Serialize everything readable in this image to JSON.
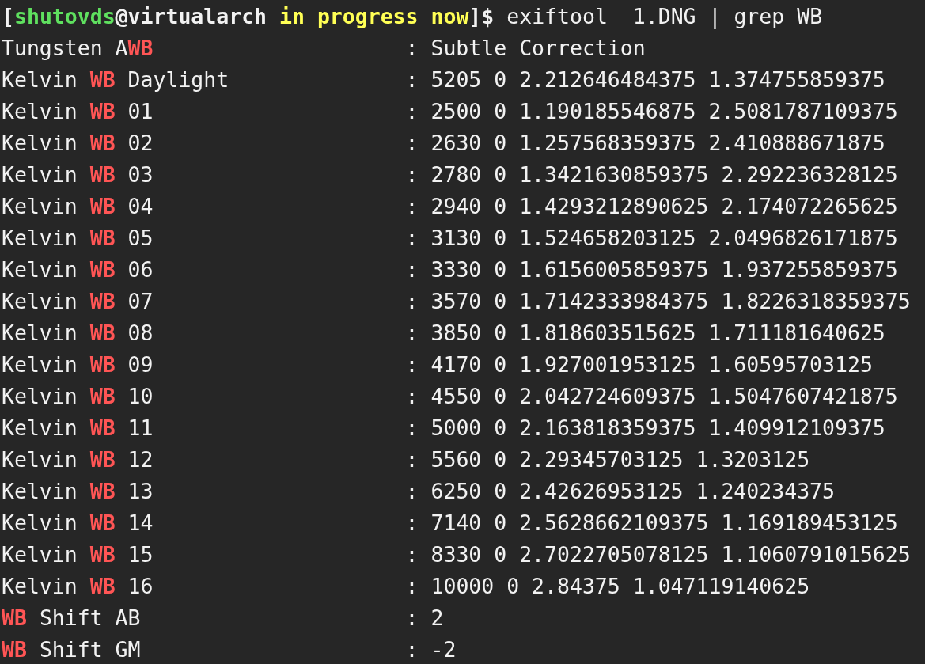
{
  "terminal": {
    "lines": [
      {
        "segments": [
          {
            "text": "[",
            "kind": "prompt"
          },
          {
            "text": "shutovds",
            "kind": "user"
          },
          {
            "text": "@virtualarch ",
            "kind": "prompt"
          },
          {
            "text": "in progress now",
            "kind": "dir"
          },
          {
            "text": "]$",
            "kind": "prompt"
          },
          {
            "text": " exiftool  1.DNG | grep WB",
            "kind": "plain"
          }
        ]
      },
      {
        "segments": [
          {
            "text": "Tungsten A",
            "kind": "plain"
          },
          {
            "text": "WB",
            "kind": "match"
          },
          {
            "text": "                    : Subtle Correction",
            "kind": "plain"
          }
        ]
      },
      {
        "segments": [
          {
            "text": "Kelvin ",
            "kind": "plain"
          },
          {
            "text": "WB",
            "kind": "match"
          },
          {
            "text": " Daylight              : 5205 0 2.212646484375 1.374755859375",
            "kind": "plain"
          }
        ]
      },
      {
        "segments": [
          {
            "text": "Kelvin ",
            "kind": "plain"
          },
          {
            "text": "WB",
            "kind": "match"
          },
          {
            "text": " 01                    : 2500 0 1.190185546875 2.5081787109375",
            "kind": "plain"
          }
        ]
      },
      {
        "segments": [
          {
            "text": "Kelvin ",
            "kind": "plain"
          },
          {
            "text": "WB",
            "kind": "match"
          },
          {
            "text": " 02                    : 2630 0 1.257568359375 2.410888671875",
            "kind": "plain"
          }
        ]
      },
      {
        "segments": [
          {
            "text": "Kelvin ",
            "kind": "plain"
          },
          {
            "text": "WB",
            "kind": "match"
          },
          {
            "text": " 03                    : 2780 0 1.3421630859375 2.292236328125",
            "kind": "plain"
          }
        ]
      },
      {
        "segments": [
          {
            "text": "Kelvin ",
            "kind": "plain"
          },
          {
            "text": "WB",
            "kind": "match"
          },
          {
            "text": " 04                    : 2940 0 1.4293212890625 2.174072265625",
            "kind": "plain"
          }
        ]
      },
      {
        "segments": [
          {
            "text": "Kelvin ",
            "kind": "plain"
          },
          {
            "text": "WB",
            "kind": "match"
          },
          {
            "text": " 05                    : 3130 0 1.524658203125 2.0496826171875",
            "kind": "plain"
          }
        ]
      },
      {
        "segments": [
          {
            "text": "Kelvin ",
            "kind": "plain"
          },
          {
            "text": "WB",
            "kind": "match"
          },
          {
            "text": " 06                    : 3330 0 1.6156005859375 1.937255859375",
            "kind": "plain"
          }
        ]
      },
      {
        "segments": [
          {
            "text": "Kelvin ",
            "kind": "plain"
          },
          {
            "text": "WB",
            "kind": "match"
          },
          {
            "text": " 07                    : 3570 0 1.7142333984375 1.8226318359375",
            "kind": "plain"
          }
        ]
      },
      {
        "segments": [
          {
            "text": "Kelvin ",
            "kind": "plain"
          },
          {
            "text": "WB",
            "kind": "match"
          },
          {
            "text": " 08                    : 3850 0 1.818603515625 1.711181640625",
            "kind": "plain"
          }
        ]
      },
      {
        "segments": [
          {
            "text": "Kelvin ",
            "kind": "plain"
          },
          {
            "text": "WB",
            "kind": "match"
          },
          {
            "text": " 09                    : 4170 0 1.927001953125 1.60595703125",
            "kind": "plain"
          }
        ]
      },
      {
        "segments": [
          {
            "text": "Kelvin ",
            "kind": "plain"
          },
          {
            "text": "WB",
            "kind": "match"
          },
          {
            "text": " 10                    : 4550 0 2.042724609375 1.5047607421875",
            "kind": "plain"
          }
        ]
      },
      {
        "segments": [
          {
            "text": "Kelvin ",
            "kind": "plain"
          },
          {
            "text": "WB",
            "kind": "match"
          },
          {
            "text": " 11                    : 5000 0 2.163818359375 1.409912109375",
            "kind": "plain"
          }
        ]
      },
      {
        "segments": [
          {
            "text": "Kelvin ",
            "kind": "plain"
          },
          {
            "text": "WB",
            "kind": "match"
          },
          {
            "text": " 12                    : 5560 0 2.29345703125 1.3203125",
            "kind": "plain"
          }
        ]
      },
      {
        "segments": [
          {
            "text": "Kelvin ",
            "kind": "plain"
          },
          {
            "text": "WB",
            "kind": "match"
          },
          {
            "text": " 13                    : 6250 0 2.42626953125 1.240234375",
            "kind": "plain"
          }
        ]
      },
      {
        "segments": [
          {
            "text": "Kelvin ",
            "kind": "plain"
          },
          {
            "text": "WB",
            "kind": "match"
          },
          {
            "text": " 14                    : 7140 0 2.5628662109375 1.169189453125",
            "kind": "plain"
          }
        ]
      },
      {
        "segments": [
          {
            "text": "Kelvin ",
            "kind": "plain"
          },
          {
            "text": "WB",
            "kind": "match"
          },
          {
            "text": " 15                    : 8330 0 2.7022705078125 1.1060791015625",
            "kind": "plain"
          }
        ]
      },
      {
        "segments": [
          {
            "text": "Kelvin ",
            "kind": "plain"
          },
          {
            "text": "WB",
            "kind": "match"
          },
          {
            "text": " 16                    : 10000 0 2.84375 1.047119140625",
            "kind": "plain"
          }
        ]
      },
      {
        "segments": [
          {
            "text": "WB",
            "kind": "match"
          },
          {
            "text": " Shift AB                     : 2",
            "kind": "plain"
          }
        ]
      },
      {
        "segments": [
          {
            "text": "WB",
            "kind": "match"
          },
          {
            "text": " Shift GM                     : -2",
            "kind": "plain"
          }
        ]
      }
    ]
  }
}
